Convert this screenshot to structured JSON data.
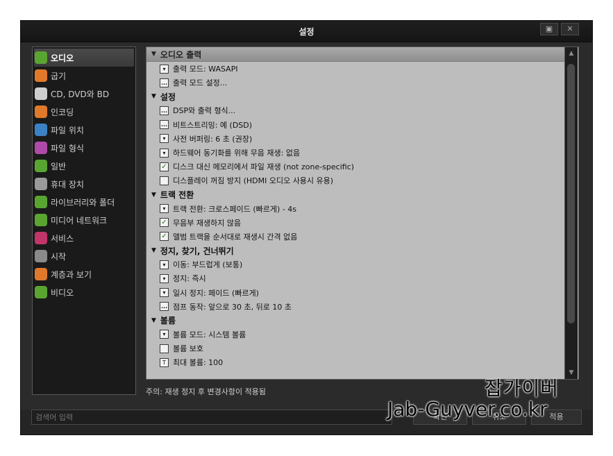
{
  "window": {
    "title": "설정"
  },
  "sidebar": {
    "items": [
      {
        "label": "오디오",
        "icon": "audio-icon",
        "color": "#5aa531"
      },
      {
        "label": "굽기",
        "icon": "burn-icon",
        "color": "#e07a2a"
      },
      {
        "label": "CD, DVD와 BD",
        "icon": "disc-icon",
        "color": "#cfcfcf"
      },
      {
        "label": "인코딩",
        "icon": "encoding-icon",
        "color": "#e07a2a"
      },
      {
        "label": "파일 위치",
        "icon": "file-location-icon",
        "color": "#3b82c4"
      },
      {
        "label": "파일 형식",
        "icon": "file-format-icon",
        "color": "#b04aa8"
      },
      {
        "label": "일반",
        "icon": "general-icon",
        "color": "#5aa531"
      },
      {
        "label": "휴대 장치",
        "icon": "portable-device-icon",
        "color": "#9a9a9a"
      },
      {
        "label": "라이브러리와 폴더",
        "icon": "library-icon",
        "color": "#5aa531"
      },
      {
        "label": "미디어 네트워크",
        "icon": "media-network-icon",
        "color": "#5aa531"
      },
      {
        "label": "서비스",
        "icon": "services-icon",
        "color": "#c2356b"
      },
      {
        "label": "시작",
        "icon": "startup-icon",
        "color": "#8a8a8a"
      },
      {
        "label": "계층과 보기",
        "icon": "views-icon",
        "color": "#e07a2a"
      },
      {
        "label": "비디오",
        "icon": "video-icon",
        "color": "#5aa531"
      }
    ]
  },
  "sections": [
    {
      "title": "오디오 출력",
      "rows": [
        {
          "type": "dropdown",
          "label": "출력 모드: WASAPI"
        },
        {
          "type": "ellipsis",
          "label": "출력 모드 설정..."
        }
      ]
    },
    {
      "title": "설정",
      "rows": [
        {
          "type": "ellipsis",
          "label": "DSP와 출력 형식..."
        },
        {
          "type": "ellipsis",
          "label": "비트스트리밍: 예 (DSD)"
        },
        {
          "type": "dropdown",
          "label": "사전 버퍼링: 6 초 (권장)"
        },
        {
          "type": "dropdown",
          "label": "하드웨어 동기화를 위해 무음 재생: 없음"
        },
        {
          "type": "checkbox",
          "checked": true,
          "label": "디스크 대신 메모리에서 파일 재생 (not zone-specific)"
        },
        {
          "type": "checkbox",
          "checked": false,
          "label": "디스플레이 꺼짐 방지 (HDMI 오디오 사용시 유용)"
        }
      ]
    },
    {
      "title": "트랙 전환",
      "rows": [
        {
          "type": "dropdown",
          "label": "트랙 전환: 크로스페이드 (빠르게) - 4s"
        },
        {
          "type": "checkbox",
          "checked": true,
          "label": "무음부 재생하지 않음"
        },
        {
          "type": "checkbox",
          "checked": true,
          "label": "앨범 트랙을 순서대로 재생시 간격 없음"
        }
      ]
    },
    {
      "title": "정지, 찾기, 건너뛰기",
      "rows": [
        {
          "type": "dropdown",
          "label": "이동: 부드럽게 (보통)"
        },
        {
          "type": "dropdown",
          "label": "정지: 즉시"
        },
        {
          "type": "dropdown",
          "label": "일시 정지: 페이드 (빠르게)"
        },
        {
          "type": "ellipsis",
          "label": "점프 동작: 앞으로 30 초, 뒤로 10 초"
        }
      ]
    },
    {
      "title": "볼륨",
      "rows": [
        {
          "type": "dropdown",
          "label": "볼륨 모드: 시스템 볼륨"
        },
        {
          "type": "checkbox",
          "checked": false,
          "label": "볼륨 보호"
        },
        {
          "type": "text",
          "label": "최대 볼륨: 100"
        }
      ]
    }
  ],
  "note": "주의: 재생 정지 후 변경사항이 적용됨",
  "footer": {
    "search_placeholder": "검색어 입력",
    "ok_label": "확인",
    "cancel_label": "취소",
    "apply_label": "적용"
  },
  "watermark": {
    "line1": "잡가이버",
    "line2": "Jab-Guyver.co.kr"
  }
}
